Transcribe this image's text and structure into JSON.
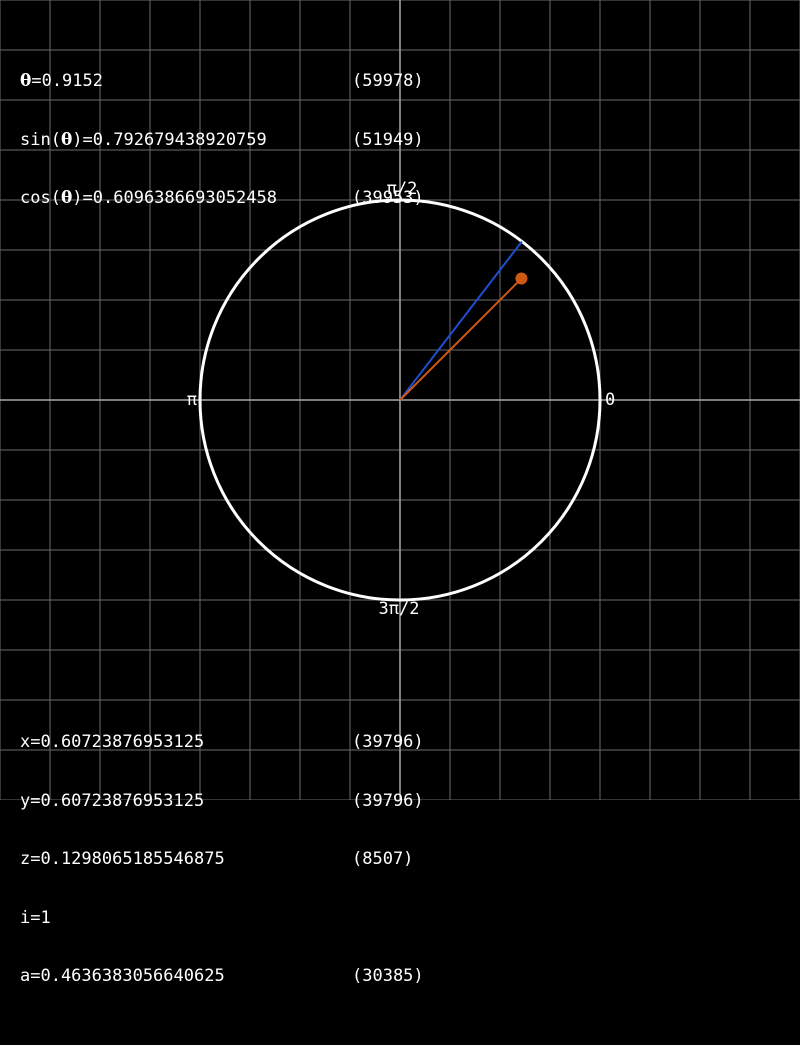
{
  "colors": {
    "background": "#000000",
    "grid": "#6b6b6b",
    "axis": "#a8a8a8",
    "circle": "#ffffff",
    "true_angle_line": "#1f4fd1",
    "cordic_vector": "#d05a14"
  },
  "readouts": {
    "theta": {
      "symbol": "θ",
      "suffix": "=0.9152",
      "count": "(59978)"
    },
    "sin": {
      "prefix": "sin(",
      "symbol": "θ",
      "suffix": ")=0.792679438920759",
      "count": "(51949)"
    },
    "cos": {
      "prefix": "cos(",
      "symbol": "θ",
      "suffix": ")=0.6096386693052458",
      "count": "(39953)"
    },
    "x": {
      "text": "x=0.60723876953125",
      "count": "(39796)"
    },
    "y": {
      "text": "y=0.60723876953125",
      "count": "(39796)"
    },
    "z": {
      "text": "z=0.1298065185546875",
      "count": "(8507)"
    },
    "i": {
      "text": "i=1"
    },
    "a": {
      "text": "a=0.4636383056640625",
      "count": "(30385)"
    }
  },
  "circle_labels": {
    "right": "0",
    "top": "π/2",
    "left": "π",
    "bottom": "3π/2"
  },
  "vectors": {
    "theta": 0.9152,
    "cos_theta": 0.6096386693052458,
    "sin_theta": 0.792679438920759,
    "cordic_x": 0.60723876953125,
    "cordic_y": 0.60723876953125
  }
}
